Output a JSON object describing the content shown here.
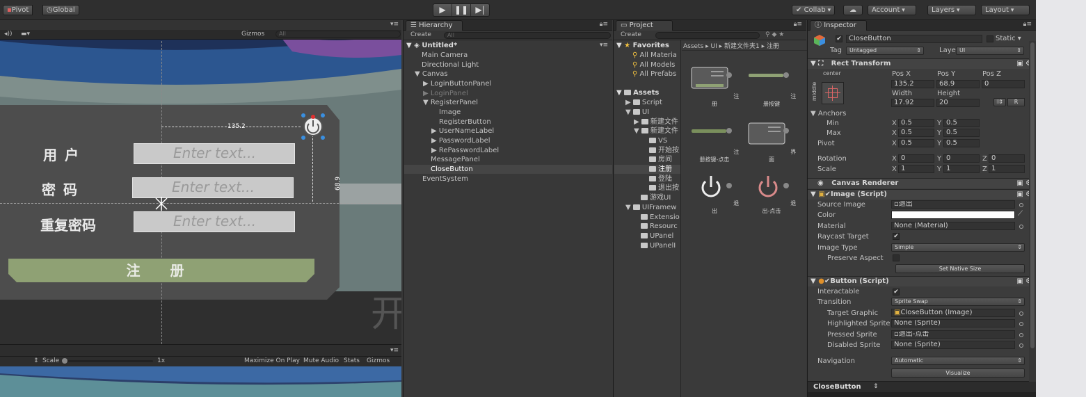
{
  "toolbar": {
    "pivot": "Pivot",
    "global": "Global",
    "collab": "Collab",
    "account": "Account",
    "layers": "Layers",
    "layout": "Layout"
  },
  "scene": {
    "gizmos": "Gizmos",
    "search_placeholder": "All",
    "label_user": "用 户",
    "label_pwd": "密 码",
    "label_repeat": "重复密码",
    "placeholder": "Enter text...",
    "register": "注 册",
    "pos_x_readout": "135.2",
    "height_readout": "68.9",
    "bg_char": "开"
  },
  "game": {
    "scale": "Scale",
    "scale_val": "1x",
    "maximize": "Maximize On Play",
    "mute": "Mute Audio",
    "stats": "Stats",
    "gizmos": "Gizmos"
  },
  "hierarchy": {
    "tab": "Hierarchy",
    "create": "Create",
    "search": "All",
    "scene": "Untitled*",
    "items": [
      "Main Camera",
      "Directional Light",
      "Canvas",
      "LoginButtonPanel",
      "LoginPanel",
      "RegisterPanel",
      "Image",
      "RegisterButton",
      "UserNameLabel",
      "PasswordLabel",
      "RePasswordLabel",
      "MessagePanel",
      "CloseButton",
      "EventSystem"
    ]
  },
  "project": {
    "tab": "Project",
    "create": "Create",
    "favorites": "Favorites",
    "fav_items": [
      "All Materia",
      "All Models",
      "All Prefabs"
    ],
    "assets": "Assets",
    "tree": [
      "Script",
      "UI",
      "新建文件",
      "新建文件",
      "VS",
      "开始按",
      "房间",
      "注册",
      "登陆",
      "退出按",
      "游戏UI",
      "UIFramew",
      "Extensio",
      "Resourc",
      "UPanel",
      "UPanelI"
    ],
    "breadcrumb": [
      "Assets",
      "UI",
      "新建文件夹1",
      "注册"
    ],
    "assets_grid": [
      "注册",
      "注册按键",
      "注册按键-点击",
      "界面",
      "退出",
      "退出-点击"
    ]
  },
  "inspector": {
    "tab": "Inspector",
    "name": "CloseButton",
    "static": "Static",
    "tag_label": "Tag",
    "tag": "Untagged",
    "layer_label": "Layer",
    "layer": "UI",
    "rect": {
      "title": "Rect Transform",
      "anchor_h": "center",
      "anchor_v": "middle",
      "posx_l": "Pos X",
      "posy_l": "Pos Y",
      "posz_l": "Pos Z",
      "posx": "135.2",
      "posy": "68.9",
      "posz": "0",
      "w_l": "Width",
      "h_l": "Height",
      "w": "17.92",
      "h": "20",
      "r": "R",
      "anchors": "Anchors",
      "min": "Min",
      "max": "Max",
      "pivot": "Pivot",
      "min_x": "0.5",
      "min_y": "0.5",
      "max_x": "0.5",
      "max_y": "0.5",
      "piv_x": "0.5",
      "piv_y": "0.5",
      "rotation": "Rotation",
      "scale": "Scale",
      "rx": "0",
      "ry": "0",
      "rz": "0",
      "sx": "1",
      "sy": "1",
      "sz": "1",
      "x": "X",
      "y": "Y",
      "z": "Z"
    },
    "canvas_renderer": "Canvas Renderer",
    "image": {
      "title": "Image (Script)",
      "source_l": "Source Image",
      "source": "退出",
      "color_l": "Color",
      "material_l": "Material",
      "material": "None (Material)",
      "raycast_l": "Raycast Target",
      "type_l": "Image Type",
      "type": "Simple",
      "preserve_l": "Preserve Aspect",
      "native": "Set Native Size"
    },
    "button": {
      "title": "Button (Script)",
      "interactable_l": "Interactable",
      "transition_l": "Transition",
      "transition": "Sprite Swap",
      "target_l": "Target Graphic",
      "target": "CloseButton (Image)",
      "high_l": "Highlighted Sprite",
      "high": "None (Sprite)",
      "pressed_l": "Pressed Sprite",
      "pressed": "退出-点击",
      "disabled_l": "Disabled Sprite",
      "disabled": "None (Sprite)",
      "nav_l": "Navigation",
      "nav": "Automatic",
      "visualize": "Visualize"
    },
    "preview": "CloseButton"
  }
}
